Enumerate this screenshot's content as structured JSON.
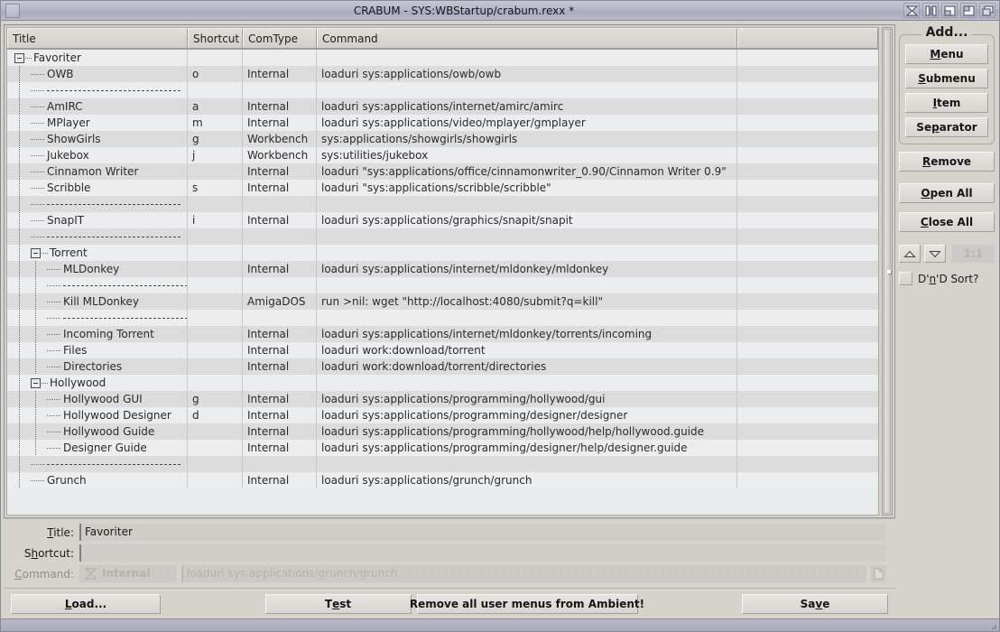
{
  "window": {
    "title": "CRABUM - SYS:WBStartup/crabum.rexx *",
    "gadgets": [
      "close-gadget",
      "iconify-gadget",
      "snapshot-gadget",
      "zoom-gadget",
      "depth-gadget"
    ]
  },
  "list": {
    "columns": [
      "Title",
      "Shortcut",
      "ComType",
      "Command",
      ""
    ],
    "rows": [
      {
        "depth": 0,
        "type": "node",
        "title": "Favoriter",
        "shortcut": "",
        "comtype": "",
        "command": ""
      },
      {
        "depth": 1,
        "type": "leaf",
        "title": "OWB",
        "shortcut": "o",
        "comtype": "Internal",
        "command": "loaduri sys:applications/owb/owb"
      },
      {
        "depth": 1,
        "type": "separator",
        "title": "",
        "shortcut": "",
        "comtype": "",
        "command": ""
      },
      {
        "depth": 1,
        "type": "leaf",
        "title": "AmIRC",
        "shortcut": "a",
        "comtype": "Internal",
        "command": "loaduri sys:applications/internet/amirc/amirc"
      },
      {
        "depth": 1,
        "type": "leaf",
        "title": "MPlayer",
        "shortcut": "m",
        "comtype": "Internal",
        "command": "loaduri sys:applications/video/mplayer/gmplayer"
      },
      {
        "depth": 1,
        "type": "leaf",
        "title": "ShowGirls",
        "shortcut": "g",
        "comtype": "Workbench",
        "command": "sys:applications/showgirls/showgirls"
      },
      {
        "depth": 1,
        "type": "leaf",
        "title": "Jukebox",
        "shortcut": "j",
        "comtype": "Workbench",
        "command": "sys:utilities/jukebox"
      },
      {
        "depth": 1,
        "type": "leaf",
        "title": "Cinnamon Writer",
        "shortcut": "",
        "comtype": "Internal",
        "command": "loaduri \"sys:applications/office/cinnamonwriter_0.90/Cinnamon Writer 0.9\""
      },
      {
        "depth": 1,
        "type": "leaf",
        "title": "Scribble",
        "shortcut": "s",
        "comtype": "Internal",
        "command": "loaduri \"sys:applications/scribble/scribble\""
      },
      {
        "depth": 1,
        "type": "separator",
        "title": "",
        "shortcut": "",
        "comtype": "",
        "command": ""
      },
      {
        "depth": 1,
        "type": "leaf",
        "title": "SnapIT",
        "shortcut": "i",
        "comtype": "Internal",
        "command": "loaduri sys:applications/graphics/snapit/snapit"
      },
      {
        "depth": 1,
        "type": "separator",
        "title": "",
        "shortcut": "",
        "comtype": "",
        "command": ""
      },
      {
        "depth": 1,
        "type": "node",
        "title": "Torrent",
        "shortcut": "",
        "comtype": "",
        "command": ""
      },
      {
        "depth": 2,
        "type": "leaf",
        "title": "MLDonkey",
        "shortcut": "",
        "comtype": "Internal",
        "command": "loaduri sys:applications/internet/mldonkey/mldonkey"
      },
      {
        "depth": 2,
        "type": "separator",
        "title": "",
        "shortcut": "",
        "comtype": "",
        "command": ""
      },
      {
        "depth": 2,
        "type": "leaf",
        "title": "Kill MLDonkey",
        "shortcut": "",
        "comtype": "AmigaDOS",
        "command": "run >nil: wget \"http://localhost:4080/submit?q=kill\""
      },
      {
        "depth": 2,
        "type": "separator",
        "title": "",
        "shortcut": "",
        "comtype": "",
        "command": ""
      },
      {
        "depth": 2,
        "type": "leaf",
        "title": "Incoming Torrent",
        "shortcut": "",
        "comtype": "Internal",
        "command": "loaduri sys:applications/internet/mldonkey/torrents/incoming"
      },
      {
        "depth": 2,
        "type": "leaf",
        "title": "Files",
        "shortcut": "",
        "comtype": "Internal",
        "command": "loaduri work:download/torrent"
      },
      {
        "depth": 2,
        "type": "leaf",
        "title": "Directories",
        "shortcut": "",
        "comtype": "Internal",
        "command": "loaduri work:download/torrent/directories"
      },
      {
        "depth": 1,
        "type": "node",
        "title": "Hollywood",
        "shortcut": "",
        "comtype": "",
        "command": ""
      },
      {
        "depth": 2,
        "type": "leaf",
        "title": "Hollywood GUI",
        "shortcut": "g",
        "comtype": "Internal",
        "command": "loaduri sys:applications/programming/hollywood/gui"
      },
      {
        "depth": 2,
        "type": "leaf",
        "title": "Hollywood Designer",
        "shortcut": "d",
        "comtype": "Internal",
        "command": "loaduri sys:applications/programming/designer/designer"
      },
      {
        "depth": 2,
        "type": "leaf",
        "title": "Hollywood Guide",
        "shortcut": "",
        "comtype": "Internal",
        "command": "loaduri sys:applications/programming/hollywood/help/hollywood.guide"
      },
      {
        "depth": 2,
        "type": "leaf",
        "title": "Designer Guide",
        "shortcut": "",
        "comtype": "Internal",
        "command": "loaduri sys:applications/programming/designer/help/designer.guide"
      },
      {
        "depth": 1,
        "type": "separator",
        "title": "",
        "shortcut": "",
        "comtype": "",
        "command": ""
      },
      {
        "depth": 1,
        "type": "leaf",
        "title": "Grunch",
        "shortcut": "",
        "comtype": "Internal",
        "command": "loaduri sys:applications/grunch/grunch"
      }
    ]
  },
  "side": {
    "add_group_title": "Add...",
    "add_buttons": [
      {
        "label": "Menu",
        "mnemonic": "M"
      },
      {
        "label": "Submenu",
        "mnemonic": "S"
      },
      {
        "label": "Item",
        "mnemonic": "I"
      },
      {
        "label": "Separator",
        "mnemonic": "p"
      }
    ],
    "remove_label": "Remove",
    "remove_mnemonic": "R",
    "open_all_label": "Open All",
    "open_all_mnemonic": "O",
    "close_all_label": "Close All",
    "close_all_mnemonic": "C",
    "move_up": "move-up-arrow",
    "move_down": "move-down-arrow",
    "scale_label": "1:1",
    "dnd_label": "D'n'D Sort?",
    "dnd_mnemonic": "n",
    "dnd_checked": false
  },
  "form": {
    "title_label": "Title:",
    "title_mnemonic": "T",
    "title_value": "Favoriter",
    "shortcut_label": "Shortcut:",
    "shortcut_mnemonic": "h",
    "shortcut_value": "",
    "command_label": "Command:",
    "command_mnemonic": "C",
    "command_type": "Internal",
    "command_value": "loaduri sys:applications/grunch/grunch",
    "command_disabled": true
  },
  "footer": {
    "load_label": "Load...",
    "load_mnemonic": "L",
    "test_label": "Test",
    "test_mnemonic": "e",
    "remove_all_label": "Remove all user menus from Ambient!",
    "save_label": "Save",
    "save_mnemonic": "v"
  },
  "colors": {
    "window_bg": "#d6d2cc",
    "titlebar": "#b4b4c6",
    "row_light": "#ebedee",
    "row_dark": "#dcdcdc",
    "text": "#2b2b2b",
    "ghost": "#b4b2ae"
  }
}
